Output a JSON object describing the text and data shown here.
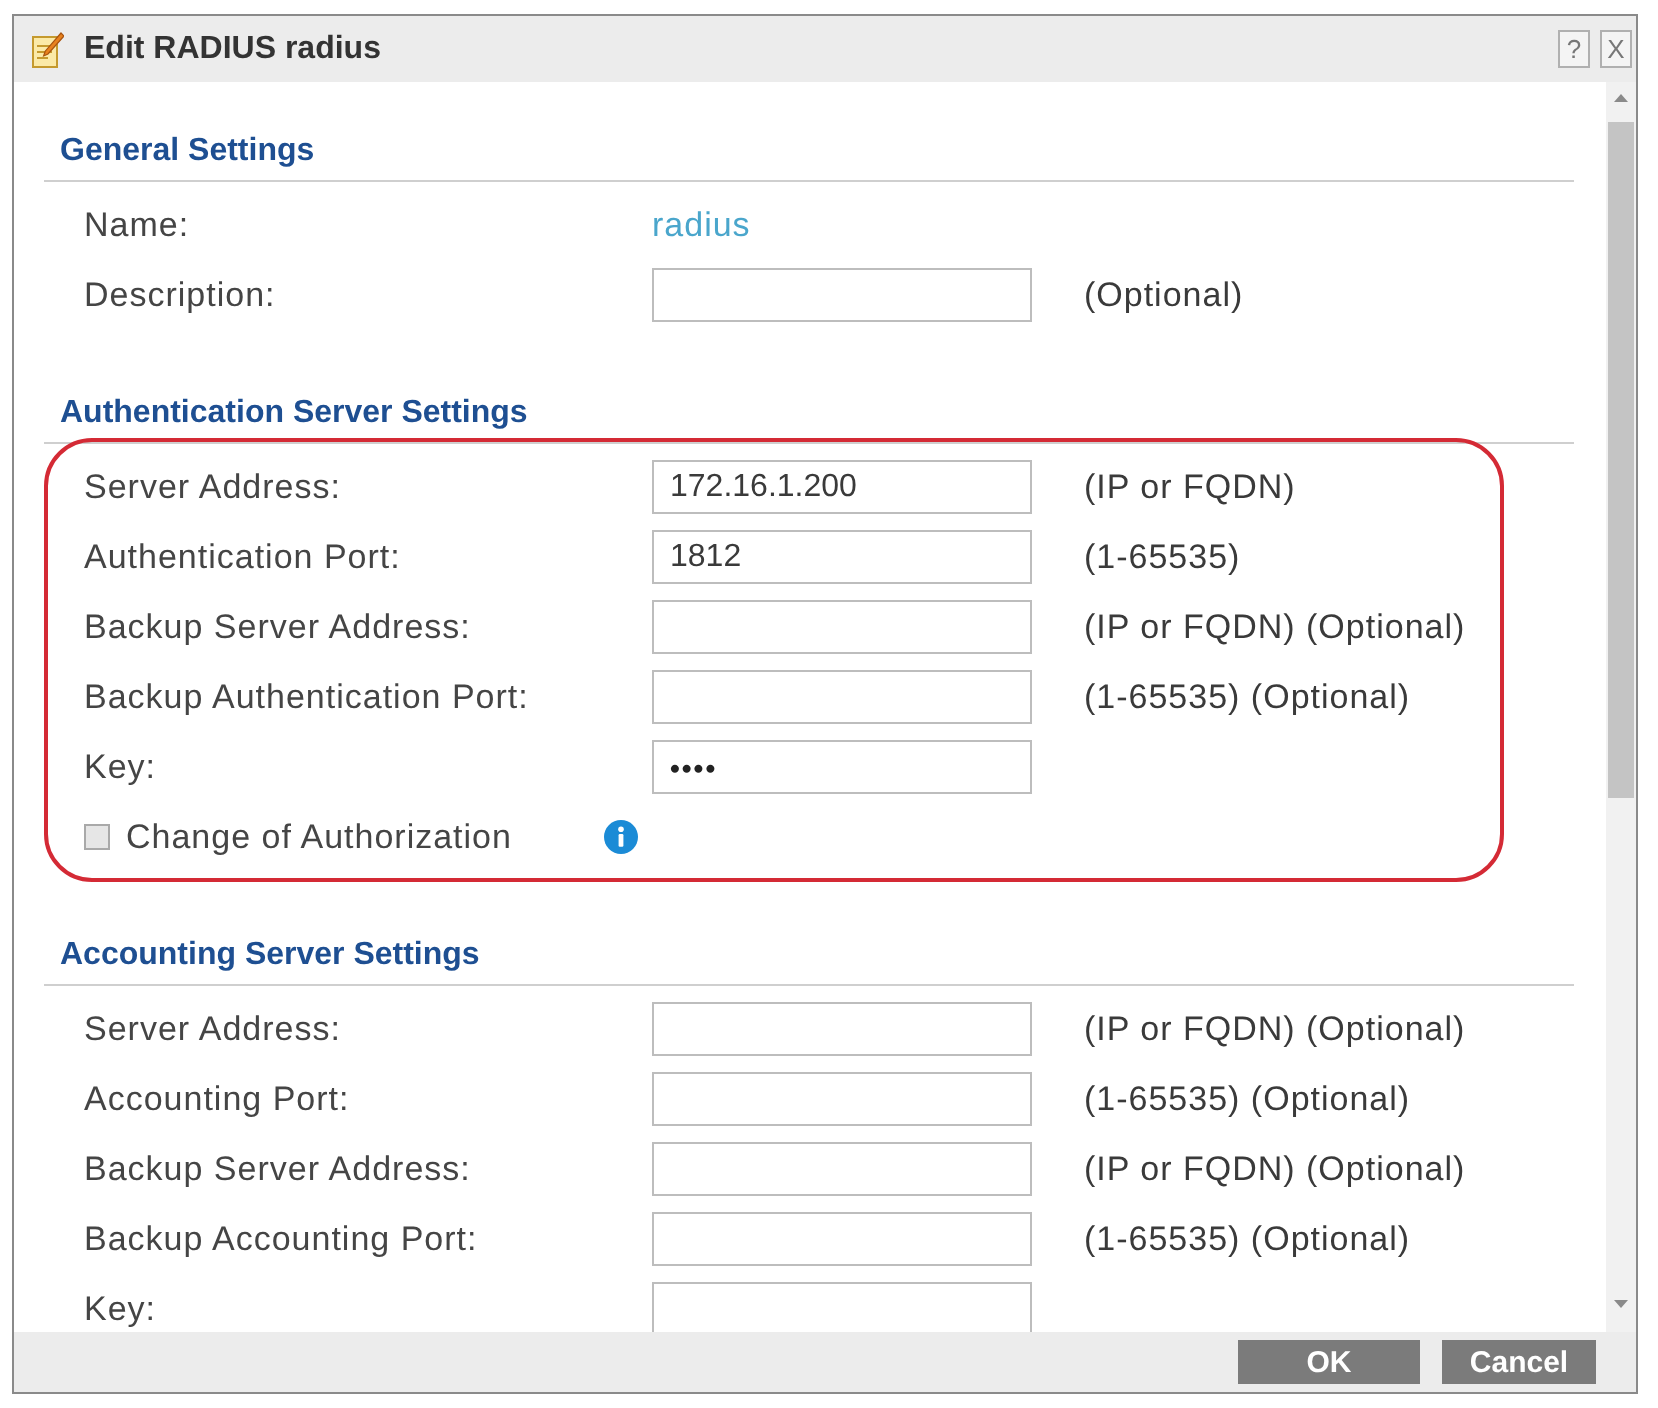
{
  "window": {
    "title": "Edit RADIUS radius",
    "title_buttons": [
      "?",
      "X"
    ]
  },
  "sections": [
    {
      "title": "General Settings",
      "highlighted": false,
      "rows": [
        {
          "kind": "text",
          "label": "Name:",
          "value": "radius"
        },
        {
          "kind": "input",
          "label": "Description:",
          "hint": "(Optional)"
        }
      ]
    },
    {
      "title": "Authentication Server Settings",
      "highlighted": true,
      "rows": [
        {
          "kind": "input",
          "label": "Server Address:",
          "value": "172.16.1.200",
          "hint": "(IP or FQDN)"
        },
        {
          "kind": "input",
          "label": "Authentication Port:",
          "value": "1812",
          "hint": "(1-65535)"
        },
        {
          "kind": "input",
          "label": "Backup Server Address:",
          "hint": "(IP or FQDN) (Optional)"
        },
        {
          "kind": "input",
          "label": "Backup Authentication Port:",
          "hint": "(1-65535) (Optional)"
        },
        {
          "kind": "password",
          "label": "Key:",
          "value": "••••"
        },
        {
          "kind": "checkbox",
          "label": "Change of Authorization",
          "checked": false,
          "info": true
        }
      ]
    },
    {
      "title": "Accounting Server Settings",
      "highlighted": false,
      "rows": [
        {
          "kind": "input",
          "label": "Server Address:",
          "hint": "(IP or FQDN) (Optional)"
        },
        {
          "kind": "input",
          "label": "Accounting Port:",
          "hint": "(1-65535) (Optional)"
        },
        {
          "kind": "input",
          "label": "Backup Server Address:",
          "hint": "(IP or FQDN) (Optional)"
        },
        {
          "kind": "input",
          "label": "Backup Accounting Port:",
          "hint": "(1-65535) (Optional)"
        },
        {
          "kind": "input",
          "label": "Key:"
        }
      ]
    }
  ],
  "buttons": [
    "OK",
    "Cancel"
  ]
}
